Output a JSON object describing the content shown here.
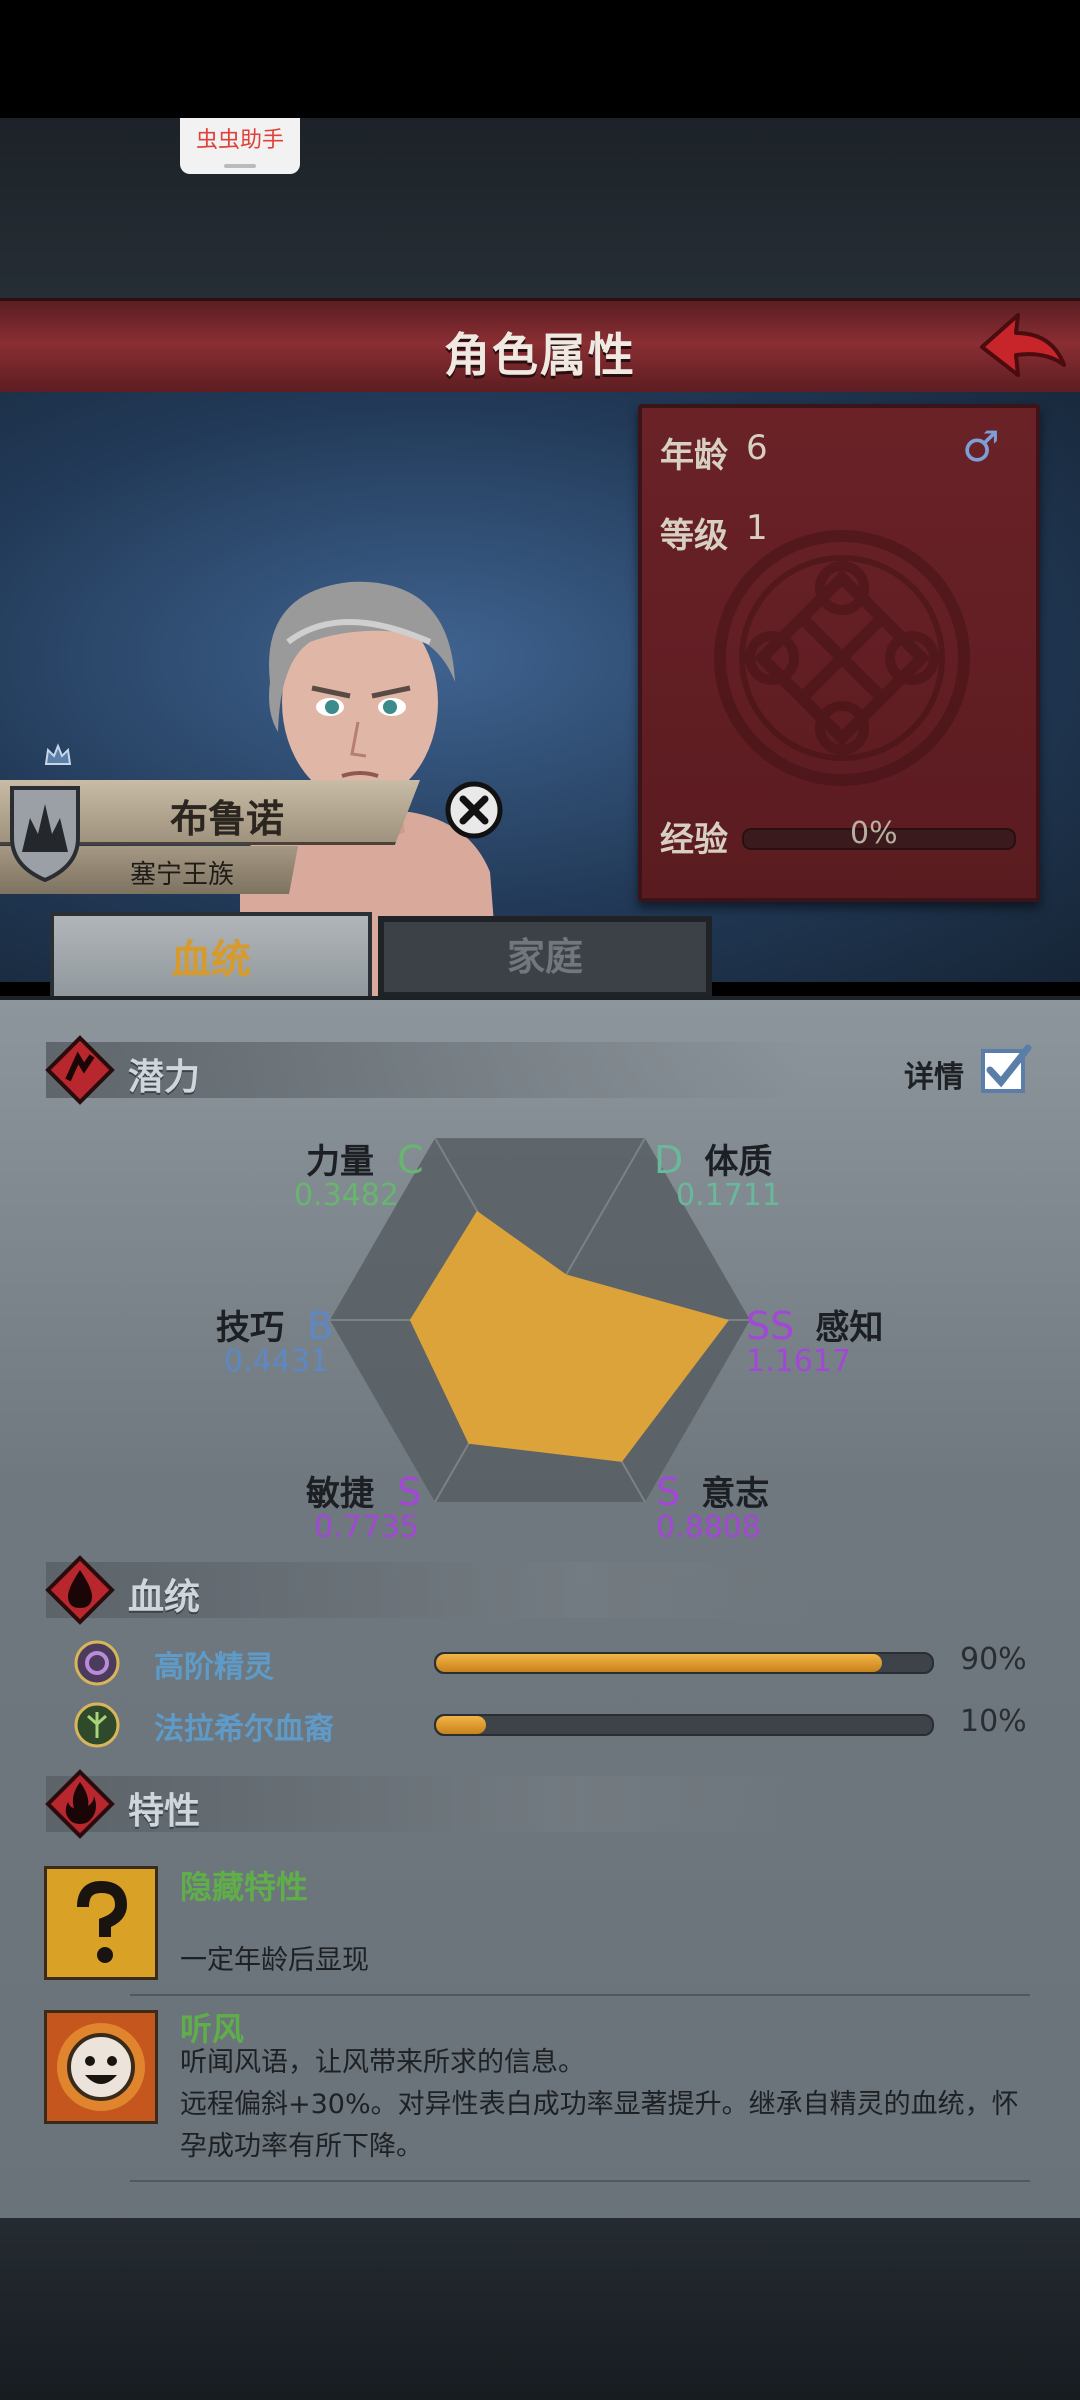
{
  "helper": {
    "label": "虫虫助手"
  },
  "header": {
    "title": "角色属性"
  },
  "character": {
    "name": "布鲁诺",
    "clan": "塞宁王族",
    "age_label": "年龄",
    "age": "6",
    "level_label": "等级",
    "level": "1",
    "exp_label": "经验",
    "exp_pct": "0%",
    "exp_fraction": 0.0,
    "gender_symbol": "♂"
  },
  "tabs": [
    {
      "label": "血统",
      "active": true
    },
    {
      "label": "家庭",
      "active": false
    }
  ],
  "potential": {
    "title": "潜力",
    "detail_label": "详情",
    "detail_checked": true,
    "attributes": [
      {
        "name": "力量",
        "grade": "C",
        "value": "0.3482"
      },
      {
        "name": "体质",
        "grade": "D",
        "value": "0.1711"
      },
      {
        "name": "感知",
        "grade": "SS",
        "value": "1.1617"
      },
      {
        "name": "意志",
        "grade": "S",
        "value": "0.8808"
      },
      {
        "name": "敏捷",
        "grade": "S",
        "value": "0.7735"
      },
      {
        "name": "技巧",
        "grade": "B",
        "value": "0.4431"
      }
    ],
    "radar_levels": [
      0.6,
      0.25,
      0.9,
      0.78,
      0.68,
      0.62
    ],
    "radar_fill": "#dba33a"
  },
  "bloodline": {
    "title": "血统",
    "items": [
      {
        "name": "高阶精灵",
        "percent": "90%",
        "fraction": 0.9
      },
      {
        "name": "法拉希尔血裔",
        "percent": "10%",
        "fraction": 0.1
      }
    ]
  },
  "traits": {
    "title": "特性",
    "items": [
      {
        "name": "隐藏特性",
        "desc": "一定年龄后显现",
        "icon": "question-icon"
      },
      {
        "name": "听风",
        "desc": "听闻风语，让风带来所求的信息。",
        "desc2": "远程偏斜+30%。对异性表白成功率显著提升。继承自精灵的血统，怀",
        "desc3": "孕成功率有所下降。",
        "icon": "smile-sun-icon"
      }
    ]
  }
}
